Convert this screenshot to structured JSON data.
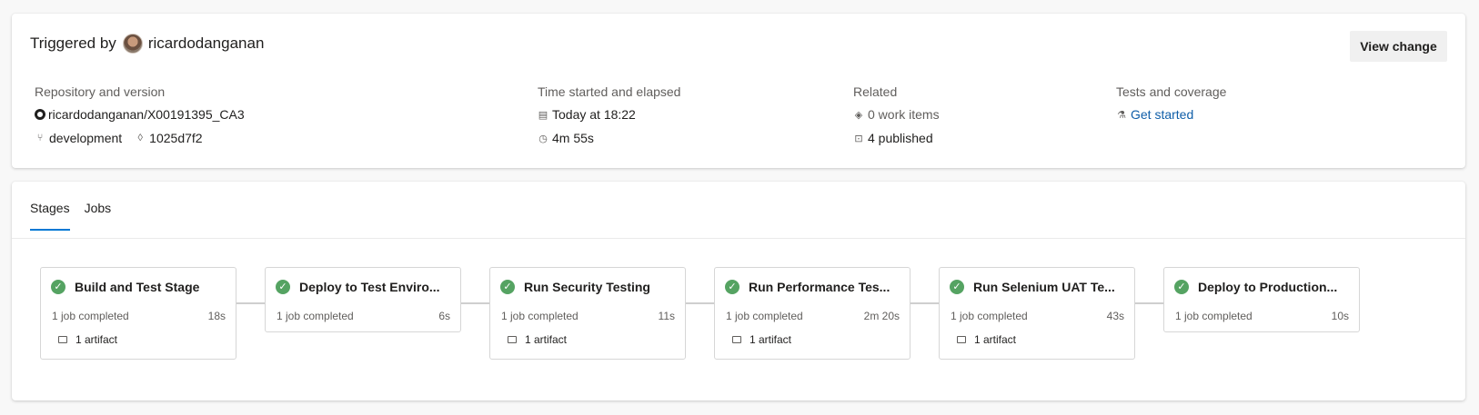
{
  "summary": {
    "triggered_prefix": "Triggered by",
    "user": "ricardodanganan",
    "view_change_label": "View change",
    "repo": {
      "label": "Repository and version",
      "name": "ricardodanganan/X00191395_CA3",
      "branch": "development",
      "commit": "1025d7f2"
    },
    "time": {
      "label": "Time started and elapsed",
      "started": "Today at 18:22",
      "elapsed": "4m 55s"
    },
    "related": {
      "label": "Related",
      "work_items": "0 work items",
      "published": "4 published"
    },
    "tests": {
      "label": "Tests and coverage",
      "link": "Get started"
    }
  },
  "tabs": [
    {
      "label": "Stages",
      "active": true
    },
    {
      "label": "Jobs",
      "active": false
    }
  ],
  "stages": [
    {
      "name": "Build and Test Stage",
      "jobs": "1 job completed",
      "duration": "18s",
      "artifact": "1 artifact",
      "status": "succeeded"
    },
    {
      "name": "Deploy to Test Enviro...",
      "jobs": "1 job completed",
      "duration": "6s",
      "artifact": null,
      "status": "succeeded"
    },
    {
      "name": "Run Security Testing",
      "jobs": "1 job completed",
      "duration": "11s",
      "artifact": "1 artifact",
      "status": "succeeded"
    },
    {
      "name": "Run Performance Tes...",
      "jobs": "1 job completed",
      "duration": "2m 20s",
      "artifact": "1 artifact",
      "status": "succeeded"
    },
    {
      "name": "Run Selenium UAT Te...",
      "jobs": "1 job completed",
      "duration": "43s",
      "artifact": "1 artifact",
      "status": "succeeded"
    },
    {
      "name": "Deploy to Production...",
      "jobs": "1 job completed",
      "duration": "10s",
      "artifact": null,
      "status": "succeeded"
    }
  ],
  "colors": {
    "success": "#55a362",
    "link": "#0f5ea8",
    "tab_underline": "#0078d4"
  }
}
